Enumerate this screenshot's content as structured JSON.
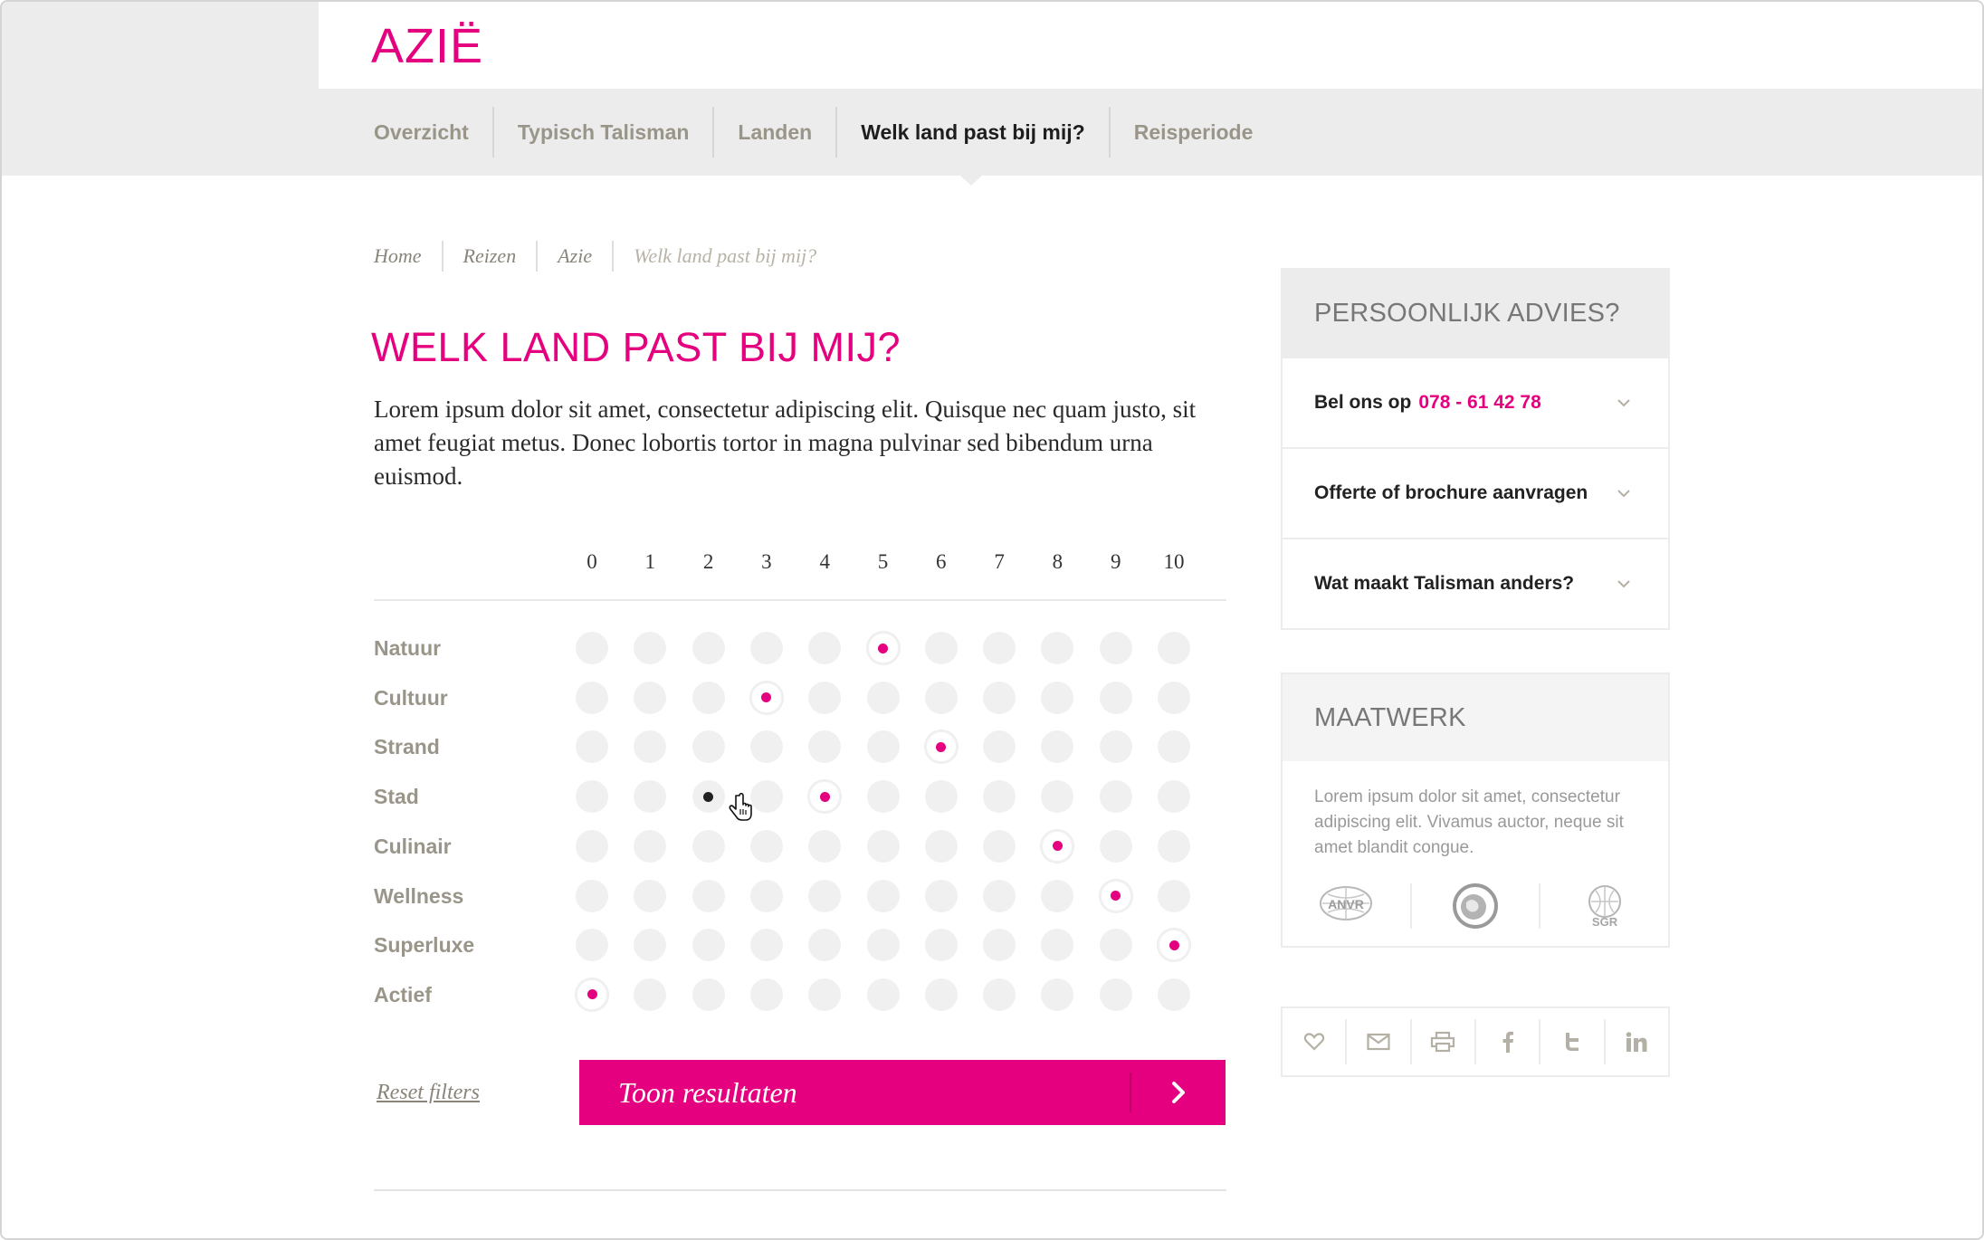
{
  "header": {
    "logo": "AZIË"
  },
  "nav": {
    "items": [
      {
        "label": "Overzicht",
        "active": false
      },
      {
        "label": "Typisch Talisman",
        "active": false
      },
      {
        "label": "Landen",
        "active": false
      },
      {
        "label": "Welk land past bij mij?",
        "active": true
      },
      {
        "label": "Reisperiode",
        "active": false
      }
    ]
  },
  "breadcrumb": [
    "Home",
    "Reizen",
    "Azie",
    "Welk land past bij mij?"
  ],
  "page": {
    "title": "WELK LAND PAST BIJ MIJ?",
    "intro": "Lorem ipsum dolor sit amet, consectetur adipiscing elit. Quisque nec quam justo, sit amet feugiat metus. Donec lobortis tortor in magna pulvinar sed bibendum urna euismod."
  },
  "rating": {
    "scale": [
      "0",
      "1",
      "2",
      "3",
      "4",
      "5",
      "6",
      "7",
      "8",
      "9",
      "10"
    ],
    "rows": [
      {
        "label": "Natuur",
        "value": 5
      },
      {
        "label": "Cultuur",
        "value": 3
      },
      {
        "label": "Strand",
        "value": 6
      },
      {
        "label": "Stad",
        "value": 4,
        "hover": 2
      },
      {
        "label": "Culinair",
        "value": 8
      },
      {
        "label": "Wellness",
        "value": 9
      },
      {
        "label": "Superluxe",
        "value": 10
      },
      {
        "label": "Actief",
        "value": 0
      }
    ],
    "accent_color": "#e4007e"
  },
  "actions": {
    "reset_label": "Reset filters",
    "submit_label": "Toon resultaten"
  },
  "sidebar": {
    "advice": {
      "title": "PERSOONLIJK ADVIES?",
      "call_label": "Bel ons op",
      "phone": "078 - 61 42 78",
      "items": [
        "Offerte of brochure aanvragen",
        "Wat maakt Talisman anders?"
      ]
    },
    "maatwerk": {
      "title": "MAATWERK",
      "text": "Lorem ipsum dolor sit amet, consectetur adipiscing elit. Vivamus auctor, neque sit amet blandit congue.",
      "logos": [
        {
          "icon": "anvr-logo",
          "text": "ANVR"
        },
        {
          "icon": "calamiteitenfonds-logo",
          "text": "Calamiteitenfonds"
        },
        {
          "icon": "sgr-logo",
          "text": "SGR"
        }
      ]
    },
    "share_icons": [
      "heart-icon",
      "mail-icon",
      "print-icon",
      "facebook-icon",
      "twitter-icon",
      "linkedin-icon"
    ]
  }
}
